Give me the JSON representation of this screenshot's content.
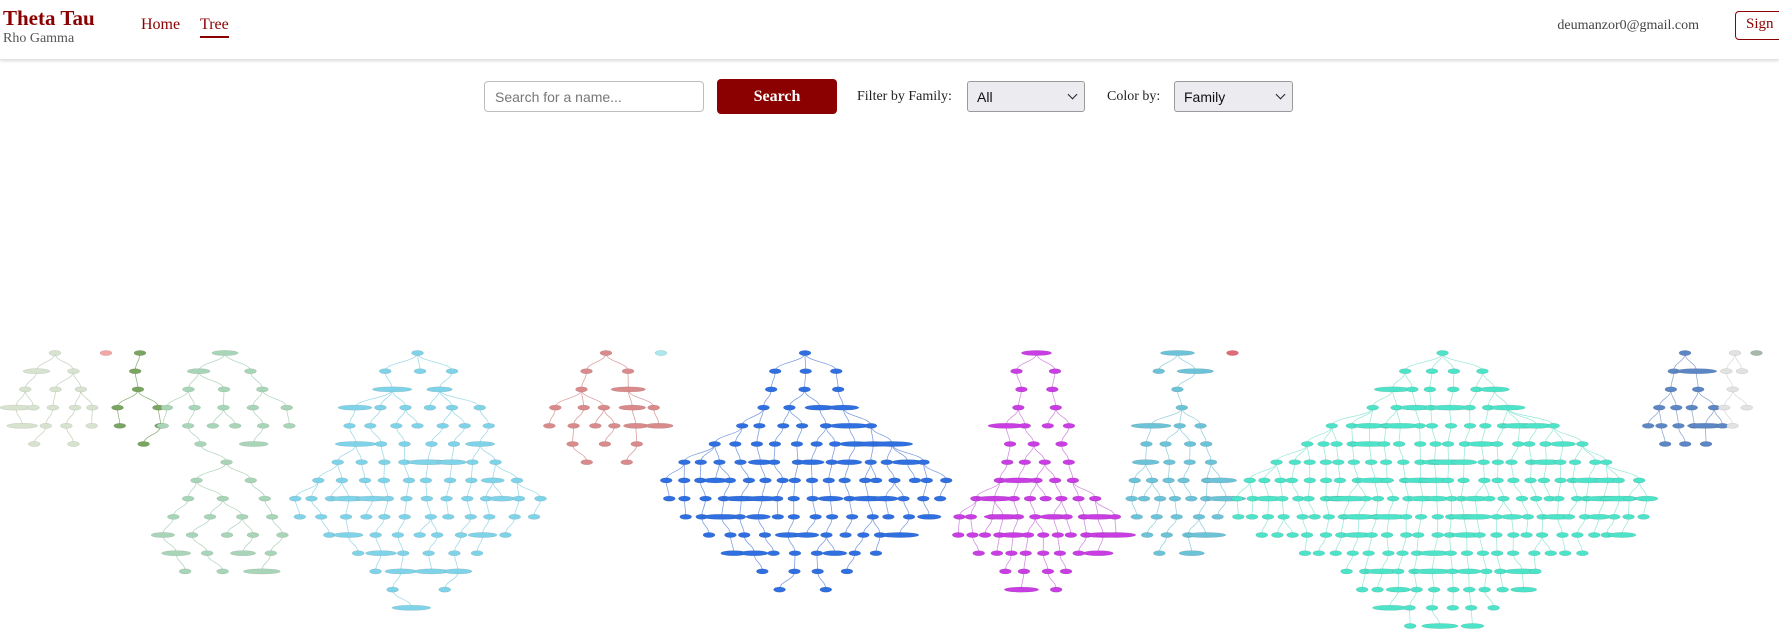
{
  "nav": {
    "brand_title": "Theta Tau",
    "brand_subtitle": "Rho Gamma",
    "links": [
      "Home",
      "Tree"
    ],
    "active_link": "Tree",
    "user_email": "deumanzor0@gmail.com",
    "sign_button": "Sign"
  },
  "controls": {
    "search_placeholder": "Search for a name...",
    "search_value": "",
    "search_button": "Search",
    "filter_label": "Filter by Family:",
    "filter_value": "All",
    "color_label": "Color by:",
    "color_value": "Family"
  },
  "tree": {
    "color_by": "Family",
    "families": [
      {
        "color": "#d7e3cf",
        "edge": "#c9d6c0"
      },
      {
        "color": "#f2a7a7",
        "edge": "#e8a0a0"
      },
      {
        "color": "#7aa560",
        "edge": "#8fb47a"
      },
      {
        "color": "#a8d5b7",
        "edge": "#b6d7c1"
      },
      {
        "color": "#7fd3e8",
        "edge": "#9fdbe9"
      },
      {
        "color": "#d98a8a",
        "edge": "#dca0a0"
      },
      {
        "color": "#a9e8ec",
        "edge": "#c0ecef"
      },
      {
        "color": "#2f6fe0",
        "edge": "#7f9fe0"
      },
      {
        "color": "#c93ee3",
        "edge": "#d48fe2"
      },
      {
        "color": "#6cc2d6",
        "edge": "#98d2df"
      },
      {
        "color": "#e06b78",
        "edge": "#e09aa0"
      },
      {
        "color": "#4de3c8",
        "edge": "#9ee9da"
      },
      {
        "color": "#5d86c4",
        "edge": "#97acd2"
      },
      {
        "color": "#e2e2e2",
        "edge": "#dddddd"
      },
      {
        "color": "#a8b8a8",
        "edge": "#c0c8c0"
      }
    ]
  }
}
